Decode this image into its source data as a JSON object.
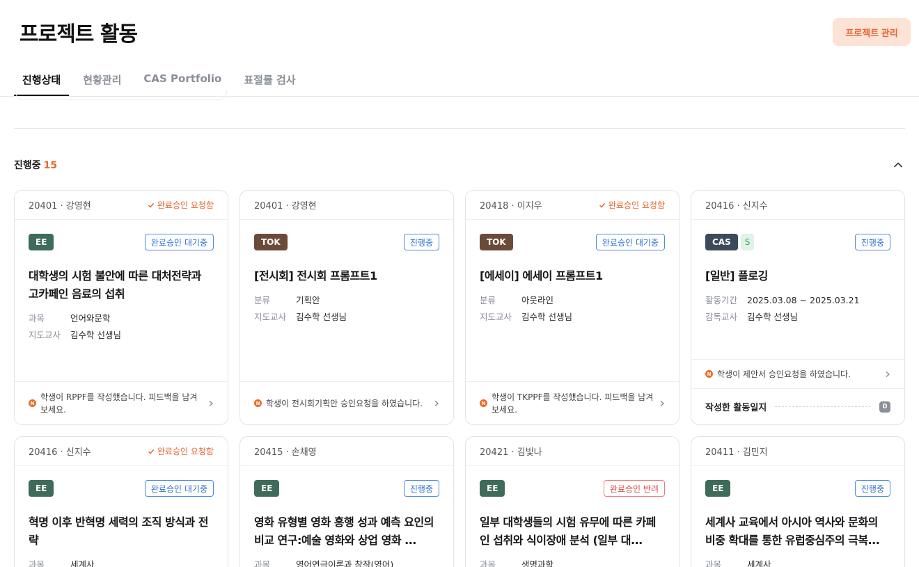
{
  "page": {
    "title": "프로젝트 활동",
    "manage_button": "프로젝트 관리"
  },
  "tabs": [
    {
      "label": "진행상태"
    },
    {
      "label": "현황관리"
    },
    {
      "label": "CAS Portfolio"
    },
    {
      "label": "표절률 검사"
    }
  ],
  "section": {
    "title": "진행중",
    "count": "15"
  },
  "cards": [
    {
      "student": "20401 · 강영현",
      "request": "완료승인 요청함",
      "tags": [
        "EE"
      ],
      "status": "완료승인 대기중",
      "title": "대학생의 시험 불안에 따른 대처전략과 고카페인 음료의 섭취",
      "meta": [
        {
          "label": "과목",
          "value": "언어와문학"
        },
        {
          "label": "지도교사",
          "value": "김수학 선생님"
        }
      ],
      "notice": "학생이 RPPF를 작성했습니다. 피드백을 남겨보세요."
    },
    {
      "student": "20401 · 강영현",
      "request": "",
      "tags": [
        "TOK"
      ],
      "status": "진행중",
      "title": "[전시회] 전시회 프롬프트1",
      "meta": [
        {
          "label": "분류",
          "value": "기획안"
        },
        {
          "label": "지도교사",
          "value": "김수학 선생님"
        }
      ],
      "notice": "학생이 전시회기획안 승인요청을 하였습니다."
    },
    {
      "student": "20418 · 이지우",
      "request": "완료승인 요청함",
      "tags": [
        "TOK"
      ],
      "status": "완료승인 대기중",
      "title": "[에세이] 에세이 프롬프트1",
      "meta": [
        {
          "label": "분류",
          "value": "아웃라인"
        },
        {
          "label": "지도교사",
          "value": "김수학 선생님"
        }
      ],
      "notice": "학생이 TKPPF를 작성했습니다. 피드백을 남겨보세요."
    },
    {
      "student": "20416 · 신지수",
      "request": "",
      "tags": [
        "CAS",
        "S"
      ],
      "status": "진행중",
      "title": "[일반] 플로깅",
      "meta": [
        {
          "label": "활동기간",
          "value": "2025.03.08 ~ 2025.03.21"
        },
        {
          "label": "감독교사",
          "value": "김수학 선생님"
        }
      ],
      "notice": "학생이 제안서 승인요청을 하였습니다.",
      "log_label": "작성한 활동일지",
      "log_count": "0"
    },
    {
      "student": "20416 · 신지수",
      "request": "완료승인 요청함",
      "tags": [
        "EE"
      ],
      "status": "완료승인 대기중",
      "title": "혁명 이후 반혁명 세력의 조직 방식과 전략",
      "meta": [
        {
          "label": "과목",
          "value": "세계사"
        }
      ]
    },
    {
      "student": "20415 · 손채영",
      "request": "",
      "tags": [
        "EE"
      ],
      "status": "진행중",
      "title": "영화 유형별 영화 흥행 성과 예측 요인의 비교 연구:예술 영화와 상업 영화 ...",
      "meta": [
        {
          "label": "과목",
          "value": "영어연극이론과 창작(영어)"
        }
      ]
    },
    {
      "student": "20421 · 김빛나",
      "request": "",
      "tags": [
        "EE"
      ],
      "status": "완료승인 반려",
      "title": "일부 대학생들의 시험 유무에 따른 카페인 섭취와 식이장애 분석 (일부 대...",
      "meta": [
        {
          "label": "과목",
          "value": "생명과학"
        }
      ]
    },
    {
      "student": "20411 · 김민지",
      "request": "",
      "tags": [
        "EE"
      ],
      "status": "진행중",
      "title": "세계사 교육에서 아시아 역사와 문화의 비중 확대를 통한 유럽중심주의 극복...",
      "meta": [
        {
          "label": "과목",
          "value": "세계사"
        }
      ]
    }
  ]
}
